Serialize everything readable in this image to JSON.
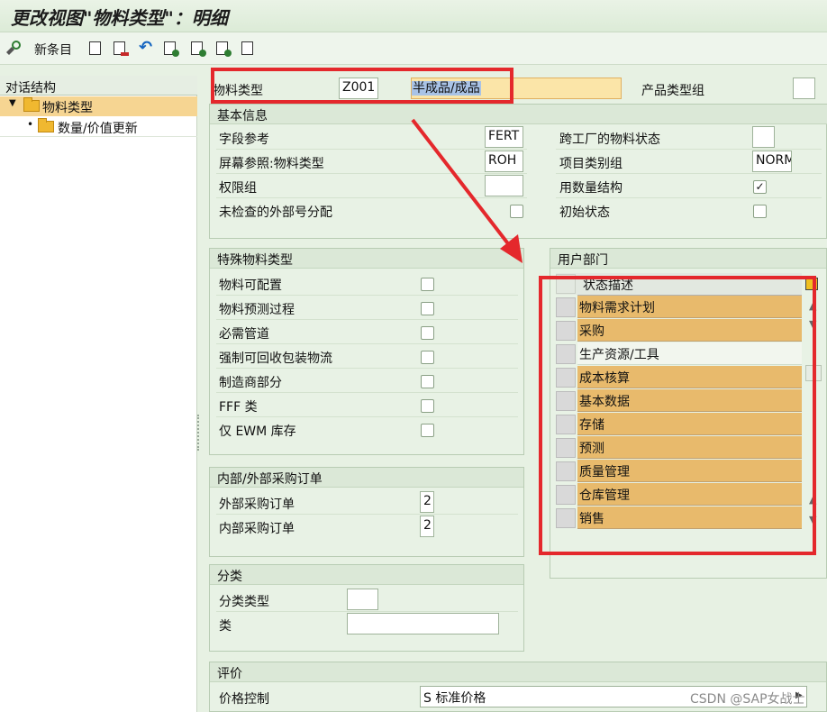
{
  "window": {
    "title": "更改视图\"物料类型\"：明细"
  },
  "toolbar": {
    "new_entry_label": "新条目"
  },
  "nav_tree": {
    "header": "对话结构",
    "items": [
      {
        "label": "物料类型"
      },
      {
        "label": "数量/价值更新"
      }
    ]
  },
  "header_fields": {
    "material_type_label": "物料类型",
    "material_type_value": "Z001",
    "material_type_desc": "半成品/成品",
    "product_type_group_label": "产品类型组",
    "product_type_group_value": ""
  },
  "basic_data": {
    "title": "基本信息",
    "field_ref_label": "字段参考",
    "field_ref_value": "FERT",
    "screen_ref_label": "屏幕参照:物料类型",
    "screen_ref_value": "ROH",
    "auth_group_label": "权限组",
    "auth_group_value": "",
    "ext_number_label": "未检查的外部号分配",
    "ext_number_checked": false,
    "cross_plant_status_label": "跨工厂的物料状态",
    "cross_plant_status_value": "",
    "item_cat_group_label": "项目类别组",
    "item_cat_group_value": "NORM",
    "qty_structure_label": "用数量结构",
    "qty_structure_checked": true,
    "initial_status_label": "初始状态",
    "initial_status_checked": false
  },
  "special_types": {
    "title": "特殊物料类型",
    "items": [
      {
        "label": "物料可配置",
        "checked": false
      },
      {
        "label": "物料预测过程",
        "checked": false
      },
      {
        "label": "必需管道",
        "checked": false
      },
      {
        "label": "强制可回收包装物流",
        "checked": false
      },
      {
        "label": "制造商部分",
        "checked": false
      },
      {
        "label": "FFF 类",
        "checked": false
      },
      {
        "label": "仅 EWM 库存",
        "checked": false
      }
    ]
  },
  "purchase_orders": {
    "title": "内部/外部采购订单",
    "external_label": "外部采购订单",
    "external_value": "2",
    "internal_label": "内部采购订单",
    "internal_value": "2"
  },
  "classification": {
    "title": "分类",
    "class_type_label": "分类类型",
    "class_type_value": "",
    "class_label": "类",
    "class_value": ""
  },
  "user_departments": {
    "title": "用户部门",
    "column_header": "状态描述",
    "rows": [
      {
        "label": "物料需求计划",
        "highlighted": true
      },
      {
        "label": "采购",
        "highlighted": true
      },
      {
        "label": "生产资源/工具",
        "highlighted": false
      },
      {
        "label": "成本核算",
        "highlighted": true
      },
      {
        "label": "基本数据",
        "highlighted": true
      },
      {
        "label": "存储",
        "highlighted": true
      },
      {
        "label": "预测",
        "highlighted": true
      },
      {
        "label": "质量管理",
        "highlighted": true
      },
      {
        "label": "仓库管理",
        "highlighted": true
      },
      {
        "label": "销售",
        "highlighted": true
      }
    ]
  },
  "valuation": {
    "title": "评价",
    "price_control_label": "价格控制",
    "price_control_value": "S 标准价格"
  },
  "watermark": "CSDN @SAP女战士",
  "colors": {
    "annotation_red": "#e4282c",
    "row_highlight": "#e8ba6c",
    "tree_selection": "#f6d592"
  }
}
